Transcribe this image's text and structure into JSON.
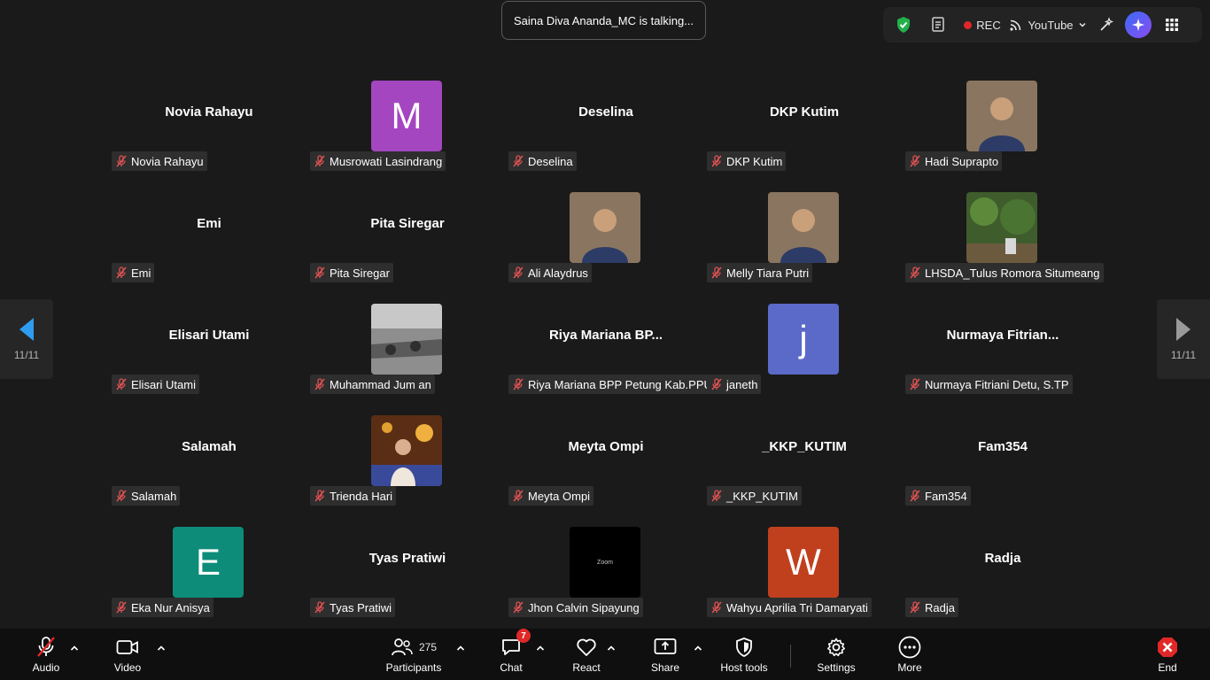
{
  "toast": {
    "text": "Saina Diva Ananda_MC is talking..."
  },
  "top_bar": {
    "icons": [
      "shield-check-icon",
      "document-icon",
      "record-dot-icon",
      "broadcast-icon",
      "magic-wand-icon",
      "ai-sparkle-icon",
      "apps-grid-icon"
    ],
    "rec_label": "REC",
    "live_label": "YouTube"
  },
  "pagination": {
    "left": "11/11",
    "right": "11/11"
  },
  "participants": [
    {
      "name": "Novia Rahayu",
      "display": "Novia Rahayu"
    },
    {
      "name": "Musrowati Lasindrang",
      "avatar_letter": "M",
      "avatar_color": "#a446c0"
    },
    {
      "name": "Deselina",
      "display": "Deselina"
    },
    {
      "name": "DKP Kutim",
      "display": "DKP Kutim"
    },
    {
      "name": "Hadi Suprapto",
      "photo": "portrait-photo"
    },
    {
      "name": "Emi",
      "display": "Emi"
    },
    {
      "name": "Pita Siregar",
      "display": "Pita Siregar"
    },
    {
      "name": "Ali Alaydrus",
      "photo": "portrait-photo"
    },
    {
      "name": "Melly Tiara Putri",
      "photo": "portrait-photo"
    },
    {
      "name": "LHSDA_Tulus Romora Situmeang",
      "photo": "nature-photo"
    },
    {
      "name": "Elisari Utami",
      "display": "Elisari Utami"
    },
    {
      "name": "Muhammad Jum an",
      "photo": "bw-photo"
    },
    {
      "name": "Riya Mariana BPP Petung Kab.PPU",
      "display": "Riya  Mariana  BP..."
    },
    {
      "name": "janeth",
      "avatar_letter": "j",
      "avatar_color": "#5b6ac8"
    },
    {
      "name": "Nurmaya Fitriani Detu, S.TP",
      "display": "Nurmaya  Fitrian..."
    },
    {
      "name": "Salamah",
      "display": "Salamah"
    },
    {
      "name": "Trienda Hari",
      "photo": "night-photo"
    },
    {
      "name": "Meyta Ompi",
      "display": "Meyta Ompi"
    },
    {
      "name": "_KKP_KUTIM",
      "display": "_KKP_KUTIM"
    },
    {
      "name": "Fam354",
      "display": "Fam354"
    },
    {
      "name": "Eka Nur Anisya",
      "avatar_letter": "E",
      "avatar_color": "#0e8c7a"
    },
    {
      "name": "Tyas Pratiwi",
      "display": "Tyas Pratiwi"
    },
    {
      "name": "Jhon Calvin Sipayung",
      "zoom_label": "Zoom"
    },
    {
      "name": "Wahyu Aprilia Tri Damaryati",
      "avatar_letter": "W",
      "avatar_color": "#c0401e"
    },
    {
      "name": "Radja",
      "display": "Radja"
    }
  ],
  "toolbar": {
    "audio": "Audio",
    "video": "Video",
    "participants": "Participants",
    "participants_count": "275",
    "chat": "Chat",
    "chat_badge": "7",
    "react": "React",
    "share": "Share",
    "host_tools": "Host tools",
    "settings": "Settings",
    "more": "More",
    "end": "End"
  }
}
